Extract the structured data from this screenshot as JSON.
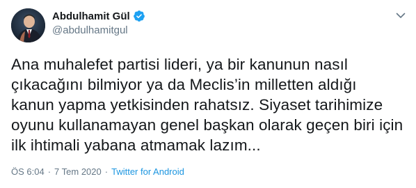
{
  "author": {
    "name": "Abdulhamit Gül",
    "handle": "@abdulhamitgul",
    "verified": true,
    "avatar_icon": "profile-photo"
  },
  "menu_icon": "chevron-down-icon",
  "tweet": {
    "lines": [
      "Ana muhalefet partisi lideri, ya bir kanunun nasıl",
      "çıkacağını bilmiyor ya da Meclis’in milletten aldığı",
      "kanun yapma yetkisinden rahatsız. Siyaset tarihimize",
      "oyunu kullanamayan genel başkan olarak geçen biri için",
      "ilk ihtimali yabana atmamak lazım..."
    ]
  },
  "meta": {
    "time": "ÖS 6:04",
    "separator1": "·",
    "date": "7 Tem 2020",
    "separator2": "·",
    "source": "Twitter for Android"
  },
  "colors": {
    "text": "#14171a",
    "secondary": "#657786",
    "link": "#1b95e0",
    "verified": "#1da1f2"
  }
}
